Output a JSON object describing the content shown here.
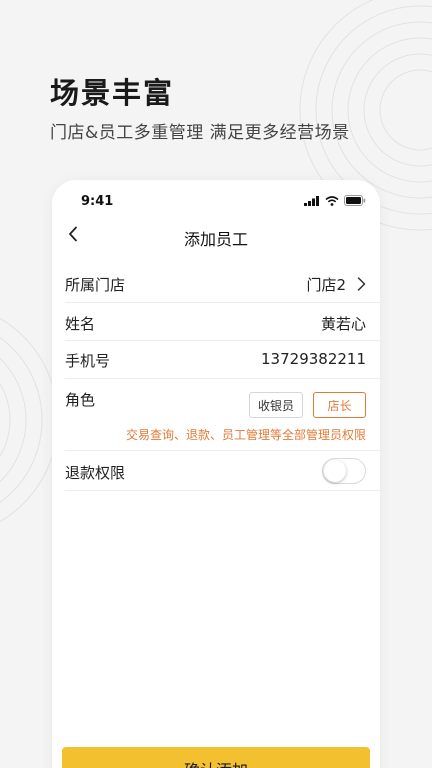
{
  "promo": {
    "title": "场景丰富",
    "subtitle": "门店&员工多重管理  满足更多经营场景"
  },
  "status_bar": {
    "time": "9:41",
    "icons": [
      "signal-icon",
      "wifi-icon",
      "battery-icon"
    ]
  },
  "nav": {
    "back_icon": "chevron-left-icon",
    "title": "添加员工"
  },
  "form": {
    "store": {
      "label": "所属门店",
      "value": "门店2"
    },
    "name": {
      "label": "姓名",
      "value": "黄若心"
    },
    "phone": {
      "label": "手机号",
      "value": "13729382211"
    },
    "role": {
      "label": "角色",
      "options": [
        "收银员",
        "店长"
      ],
      "selected": "店长",
      "note": "交易查询、退款、员工管理等全部管理员权限"
    },
    "refund": {
      "label": "退款权限",
      "enabled": false
    }
  },
  "confirm_button": {
    "label": "确认添加"
  },
  "colors": {
    "accent": "#e27a37",
    "button": "#f3c130",
    "background": "#f4f4f4"
  }
}
